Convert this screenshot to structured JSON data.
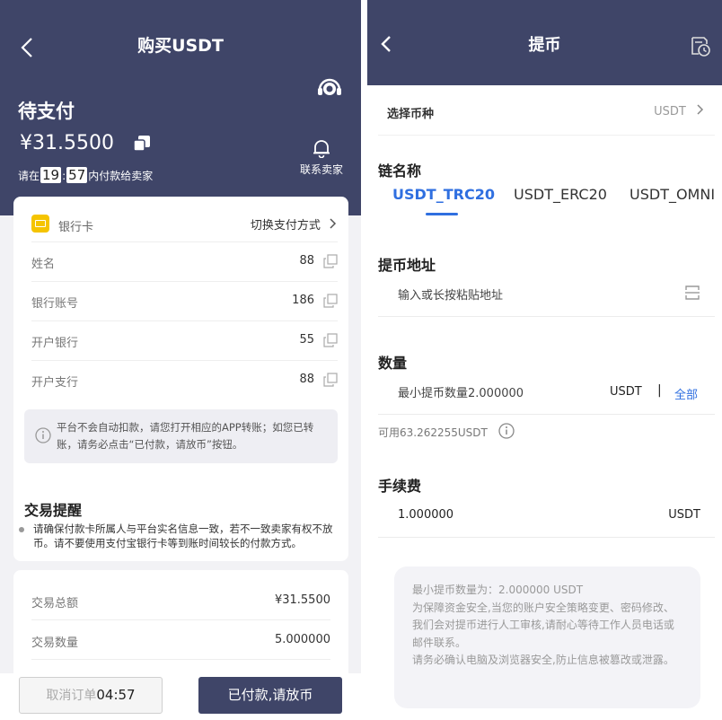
{
  "left": {
    "title": "购买USDT",
    "status": "待支付",
    "amount": "¥31.5500",
    "countdown": {
      "prefix": "请在",
      "min": "19",
      "colon": ":",
      "sec": "57",
      "suffix": "内付款给卖家"
    },
    "contact_label": "联系卖家",
    "payment": {
      "method": "银行卡",
      "switch_label": "切换支付方式"
    },
    "fields": [
      {
        "label": "姓名",
        "value": "88"
      },
      {
        "label": "银行账号",
        "value": "186"
      },
      {
        "label": "开户银行",
        "value": "55"
      },
      {
        "label": "开户支行",
        "value": "88"
      }
    ],
    "notice": "平台不会自动扣款，请您打开相应的APP转账；如您已转账，请务必点击“已付款，请放币”按钮。",
    "tip_title": "交易提醒",
    "tip_text": "请确保付款卡所属人与平台实名信息一致，若不一致卖家有权不放币。请不要使用支付宝银行卡等到账时间较长的付款方式。",
    "transaction": [
      {
        "label": "交易总额",
        "value": "¥31.5500"
      },
      {
        "label": "交易数量",
        "value": "5.000000"
      }
    ],
    "cancel_label": "取消订单",
    "cancel_countdown": "04:57",
    "paid_label": "已付款,请放币"
  },
  "right": {
    "title": "提币",
    "select_coin_label": "选择币种",
    "selected_coin": "USDT",
    "chain_title": "链名称",
    "chains": [
      "USDT_TRC20",
      "USDT_ERC20",
      "USDT_OMNI"
    ],
    "active_chain": "USDT_TRC20",
    "address_title": "提币地址",
    "address_placeholder": "输入或长按粘贴地址",
    "qty_title": "数量",
    "qty_placeholder": "最小提币数量2.000000",
    "qty_unit": "USDT",
    "qty_sep": "|",
    "all_label": "全部",
    "available": "可用63.262255USDT",
    "fee_title": "手续费",
    "fee_value": "1.000000",
    "fee_unit": "USDT",
    "note_lines": [
      "最小提币数量为：2.000000 USDT",
      "为保障资金安全,当您的账户安全策略变更、密码修改、我们会对提币进行人工审核,请耐心等待工作人员电话或邮件联系。",
      "请务必确认电脑及浏览器安全,防止信息被篡改或泄露。"
    ]
  },
  "colors": {
    "header": "#3f4568",
    "accent": "#2f6fe0",
    "card_icon": "#f5c400"
  }
}
